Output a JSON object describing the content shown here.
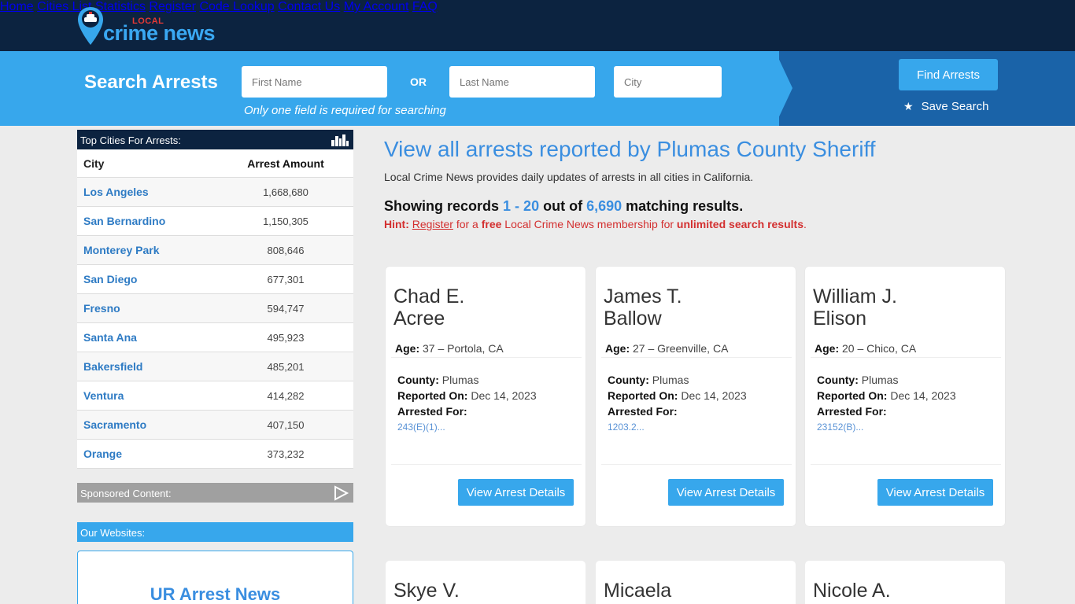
{
  "brand": {
    "local": "LOCAL",
    "name": "crime news"
  },
  "nav": [
    "Home",
    "Cities List",
    "Statistics",
    "Register",
    "Code Lookup",
    "Contact Us",
    "My Account",
    "FAQ"
  ],
  "search": {
    "title": "Search Arrests",
    "first_placeholder": "First Name",
    "or_label": "OR",
    "last_placeholder": "Last Name",
    "city_placeholder": "City",
    "required_note": "Only one field is required for searching",
    "find_label": "Find Arrests",
    "save_label": "Save Search"
  },
  "sidebar": {
    "top_cities_title": "Top Cities For Arrests:",
    "col_city": "City",
    "col_amount": "Arrest Amount",
    "rows": [
      {
        "city": "Los Angeles",
        "amount": "1,668,680"
      },
      {
        "city": "San Bernardino",
        "amount": "1,150,305"
      },
      {
        "city": "Monterey Park",
        "amount": "808,646"
      },
      {
        "city": "San Diego",
        "amount": "677,301"
      },
      {
        "city": "Fresno",
        "amount": "594,747"
      },
      {
        "city": "Santa Ana",
        "amount": "495,923"
      },
      {
        "city": "Bakersfield",
        "amount": "485,201"
      },
      {
        "city": "Ventura",
        "amount": "414,282"
      },
      {
        "city": "Sacramento",
        "amount": "407,150"
      },
      {
        "city": "Orange",
        "amount": "373,232"
      }
    ],
    "sponsored_title": "Sponsored Content:",
    "websites_title": "Our Websites:",
    "website_name": "UR Arrest News"
  },
  "main": {
    "title": "View all arrests reported by Plumas County Sheriff",
    "subtitle": "Local Crime News provides daily updates of arrests in all cities in California.",
    "showing_prefix": "Showing records",
    "showing_range": "1 - 20",
    "showing_mid": "out of",
    "showing_total": "6,690",
    "showing_suffix": "matching results.",
    "hint_label": "Hint:",
    "hint_register": "Register",
    "hint_text1": "for a",
    "hint_free": "free",
    "hint_text2": "Local Crime News membership for",
    "hint_unlimited": "unlimited search results",
    "hint_end": "."
  },
  "labels": {
    "age": "Age:",
    "county": "County:",
    "reported": "Reported On:",
    "arrested_for": "Arrested For:",
    "view_details": "View Arrest Details"
  },
  "arrests": [
    {
      "first": "Chad E.",
      "last": "Acree",
      "age_loc": "37 – Portola, CA",
      "county": "Plumas",
      "date": "Dec 14, 2023",
      "charge": "243(E)(1)..."
    },
    {
      "first": "James T.",
      "last": "Ballow",
      "age_loc": "27 – Greenville, CA",
      "county": "Plumas",
      "date": "Dec 14, 2023",
      "charge": "1203.2..."
    },
    {
      "first": "William J.",
      "last": "Elison",
      "age_loc": "20 – Chico, CA",
      "county": "Plumas",
      "date": "Dec 14, 2023",
      "charge": "23152(B)..."
    }
  ],
  "partial_arrests": [
    "Skye V.",
    "Micaela",
    "Nicole A."
  ],
  "colors": {
    "navy": "#0c2340",
    "accent": "#37a7ec",
    "link": "#2e7bc4",
    "hint": "#d32f2f"
  }
}
